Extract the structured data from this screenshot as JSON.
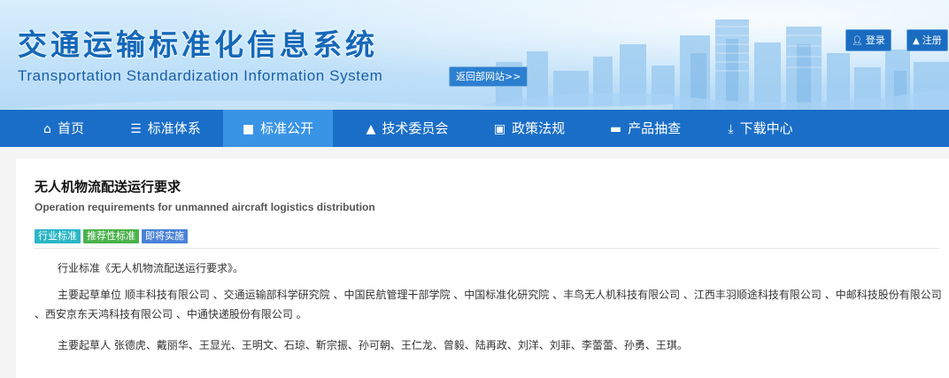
{
  "header": {
    "title_cn": "交通运输标准化信息系统",
    "title_en": "Transportation Standardization Information System",
    "back_link": "返回部网站>>",
    "login": {
      "label": "登录",
      "icon": "user-icon"
    },
    "register": {
      "label": "注册",
      "icon": "graduation-cap-icon"
    }
  },
  "nav": {
    "items": [
      {
        "label": "首页",
        "icon": "home-icon"
      },
      {
        "label": "标准体系",
        "icon": "list-icon"
      },
      {
        "label": "标准公开",
        "icon": "book-icon",
        "active": true
      },
      {
        "label": "技术委员会",
        "icon": "user-icon"
      },
      {
        "label": "政策法规",
        "icon": "monitor-icon"
      },
      {
        "label": "产品抽查",
        "icon": "id-card-icon"
      },
      {
        "label": "下载中心",
        "icon": "download-icon"
      }
    ]
  },
  "standard": {
    "title": "无人机物流配送运行要求",
    "subtitle": "Operation requirements for unmanned aircraft logistics distribution",
    "tags": [
      "行业标准",
      "推荐性标准",
      "即将实施"
    ],
    "paragraphs": [
      "行业标准《无人机物流配送运行要求》。",
      "主要起草单位 顺丰科技有限公司 、交通运输部科学研究院 、中国民航管理干部学院 、中国标准化研究院 、丰鸟无人机科技有限公司 、江西丰羽顺途科技有限公司 、中邮科技股份有限公司 、西安京东天鸿科技有限公司 、中通快递股份有限公司 。",
      "主要起草人 张德虎、戴丽华、王显光、王明文、石琼、靳宗振、孙可朝、王仁龙、曾毅、陆再政、刘洋、刘菲、李蕾蕾、孙勇、王琪。"
    ]
  },
  "colors": {
    "nav_bg": "#1a6ec8",
    "nav_active": "#3a94e6",
    "title_blue": "#1568b8",
    "tag_industry": "#2bb6c6",
    "tag_recommended": "#4bb24b",
    "tag_upcoming": "#4a82d8"
  }
}
